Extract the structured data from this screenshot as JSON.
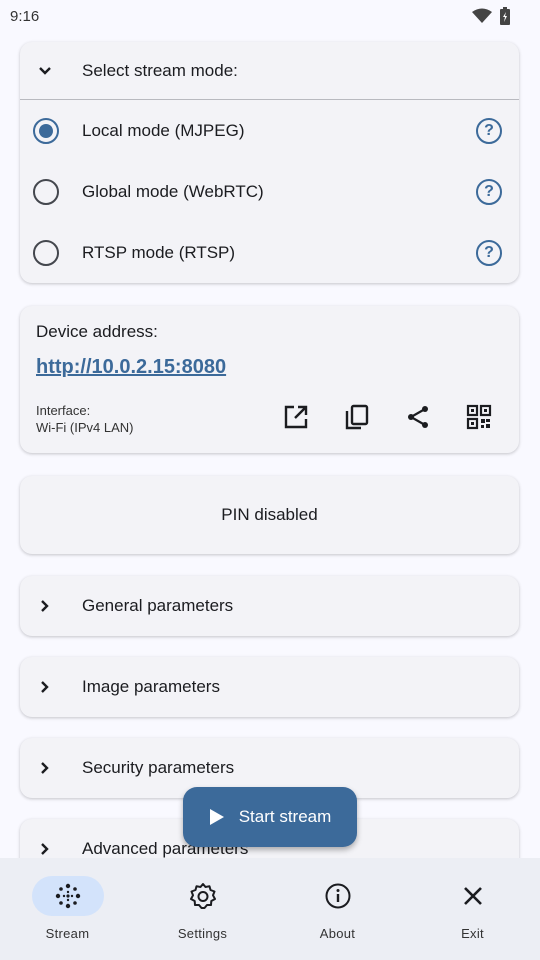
{
  "status": {
    "time": "9:16",
    "wifi_icon": "wifi-icon",
    "battery_icon": "battery-icon"
  },
  "mode_card": {
    "title": "Select stream mode:",
    "modes": [
      {
        "label": "Local mode (MJPEG)",
        "selected": true
      },
      {
        "label": "Global mode (WebRTC)",
        "selected": false
      },
      {
        "label": "RTSP mode (RTSP)",
        "selected": false
      }
    ],
    "help_glyph": "?"
  },
  "address_card": {
    "title": "Device address:",
    "url": "http://10.0.2.15:8080",
    "interface_label": "Interface:",
    "interface_value": "Wi-Fi (IPv4 LAN)",
    "actions": [
      "open-external-icon",
      "copy-icon",
      "share-icon",
      "qr-code-icon"
    ]
  },
  "pin_card": {
    "text": "PIN disabled"
  },
  "params": [
    {
      "label": "General parameters"
    },
    {
      "label": "Image parameters"
    },
    {
      "label": "Security parameters"
    },
    {
      "label": "Advanced parameters"
    }
  ],
  "fab": {
    "label": "Start stream"
  },
  "nav": [
    {
      "label": "Stream",
      "icon": "stream-icon",
      "active": true
    },
    {
      "label": "Settings",
      "icon": "gear-icon",
      "active": false
    },
    {
      "label": "About",
      "icon": "info-icon",
      "active": false
    },
    {
      "label": "Exit",
      "icon": "close-icon",
      "active": false
    }
  ],
  "colors": {
    "primary": "#3c6a9a",
    "nav_active_pill": "#d3e3fb",
    "background": "#f9f9ff"
  }
}
